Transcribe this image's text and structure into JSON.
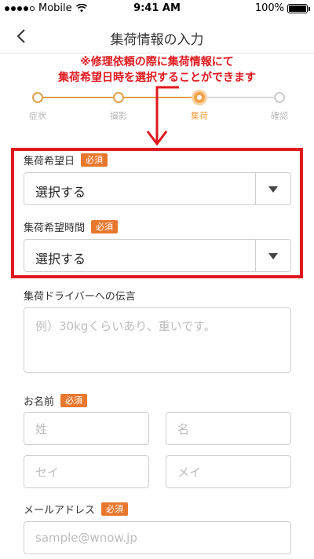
{
  "status_bar": {
    "carrier": "Mobile",
    "time": "9:41 AM",
    "battery": "100%"
  },
  "nav": {
    "title": "集荷情報の入力"
  },
  "annotation": {
    "line1": "※修理依頼の際に集荷情報にて",
    "line2": "集荷希望日時を選択することができます",
    "color": "#e0191f"
  },
  "stepper": {
    "steps": [
      {
        "label": "症状",
        "state": "done"
      },
      {
        "label": "撮影",
        "state": "done"
      },
      {
        "label": "集荷",
        "state": "active"
      },
      {
        "label": "確認",
        "state": "todo"
      }
    ]
  },
  "form": {
    "pickup_date": {
      "label": "集荷希望日",
      "required": "必須",
      "value": "選択する"
    },
    "pickup_time": {
      "label": "集荷希望時間",
      "required": "必須",
      "value": "選択する"
    },
    "driver_message": {
      "label": "集荷ドライバーへの伝言",
      "placeholder": "例）30kgくらいあり、重いです。"
    },
    "name": {
      "label": "お名前",
      "required": "必須",
      "last_name_placeholder": "姓",
      "first_name_placeholder": "名",
      "last_kana_placeholder": "セイ",
      "first_kana_placeholder": "メイ"
    },
    "email": {
      "label": "メールアドレス",
      "required": "必須",
      "placeholder": "sample@wnow.jp"
    }
  },
  "colors": {
    "accent": "#e9782f",
    "step_active": "#f3a54d",
    "highlight": "#e0191f"
  }
}
